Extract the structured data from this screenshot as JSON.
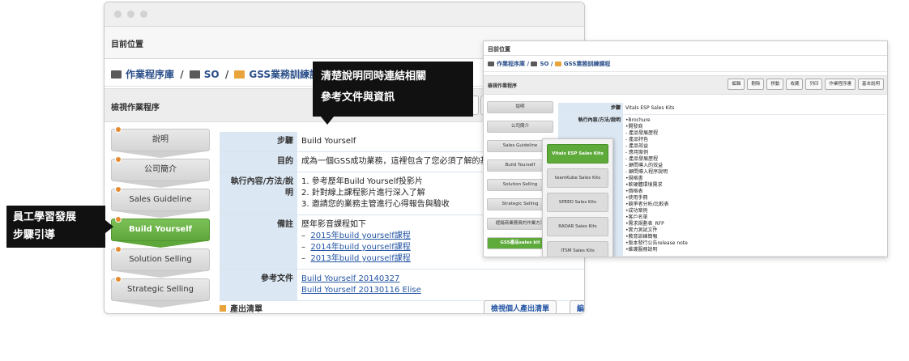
{
  "back": {
    "location_label": "目前位置",
    "breadcrumb": [
      "作業程序庫",
      "SO",
      "GSS業務訓練課程"
    ],
    "panel_title": "檢視作業程序",
    "steps": [
      "說明",
      "公司簡介",
      "Sales Guideline",
      "Build Yourself",
      "Solution Selling",
      "Strategic Selling"
    ],
    "rows": {
      "step_label": "步驟",
      "step_value": "Build Yourself",
      "purpose_label": "目的",
      "purpose_value": "成為一個GSS成功業務，這裡包含了您必須了解的基本態度",
      "method_label": "執行內容/方法/說明",
      "method_items": [
        "1. 參考歷年Build Yourself投影片",
        "2. 針對線上課程影片進行深入了解",
        "3. 邀請您的業務主管進行心得報告與驗收"
      ],
      "notes_label": "備註",
      "notes_intro": "歷年影音課程如下",
      "notes_links": [
        "2015年build yourself課程",
        "2014年build yourself課程",
        "2013年build yourself課程"
      ],
      "docs_label": "參考文件",
      "docs_links": [
        "Build Yourself 20140327",
        "Build Yourself 20130116 Elise"
      ]
    },
    "output_label": "產出清單",
    "output_button": "檢視個人產出清單",
    "edit_button": "編"
  },
  "callouts": {
    "top": "清楚說明同時連結相關參考文件與資訊",
    "top_line1": "清楚說明同時連結相關",
    "top_line2": "參考文件與資訊",
    "left_line1": "員工學習發展",
    "left_line2": "步驟引導"
  },
  "front": {
    "location_label": "目前位置",
    "breadcrumb": [
      "作業程序庫",
      "SO",
      "GSS業務訓練課程"
    ],
    "panel_title": "檢視作業程序",
    "tools": [
      "編輯",
      "刪除",
      "移動",
      "收藏",
      "列印",
      "作業程序書",
      "基本說明"
    ],
    "steps": [
      "說明",
      "公司簡介",
      "Sales Guideline",
      "Build Yourself",
      "Solution Selling",
      "Strategic Selling",
      "經銷商業務員的作業方法",
      "GSS產品sales kit"
    ],
    "popup": [
      "Vitals ESP Sales Kits",
      "teamKube Sales Kits",
      "SPEED Sales Kits",
      "RADAR Sales Kits",
      "ITSM Sales Kits"
    ],
    "step_label": "步驟",
    "step_value": "Vitals ESP Sales Kits",
    "method_label": "執行內容/方法/說明",
    "list": [
      "•Brochure",
      "•開發商",
      "  - 產品發展歷程",
      "  - 產品特色",
      "  - 產品效益",
      "  - 應用案例",
      "  - 產品發展歷程",
      "  - 顧問導入的效益",
      "  - 顧問導入程序說明",
      "•規格書",
      "•軟硬體環境需求",
      "•價格表",
      "•使用手冊",
      "•競爭者分析/比較表",
      "•成功案例",
      "•客戶名單",
      "•需求規劃表_RFP",
      "•實力測試文件",
      "•教育訓練簡報",
      "•版本發行公告release note",
      "•維護服務說明"
    ]
  },
  "colors": {
    "link": "#2455a4",
    "active_step": "#5ea73b",
    "label_bg": "#dbe7f3",
    "callout_bg": "#111111",
    "folder_orange": "#e8a33b"
  }
}
